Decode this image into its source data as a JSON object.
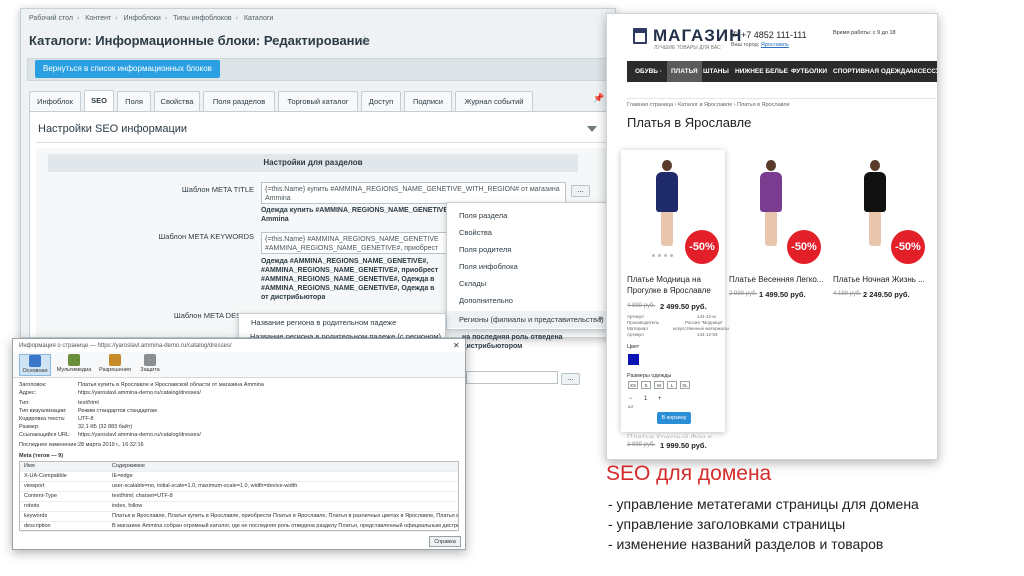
{
  "admin": {
    "breadcrumbs": [
      "Рабочий стол",
      "Контент",
      "Инфоблоки",
      "Типы инфоблоков",
      "Каталоги"
    ],
    "title": "Каталоги: Информационные блоки: Редактирование",
    "back_button": "Вернуться в список информационных блоков",
    "tabs": [
      "Инфоблок",
      "SEO",
      "Поля",
      "Свойства",
      "Поля разделов",
      "Торговый каталог",
      "Доступ",
      "Подписи",
      "Журнал событий"
    ],
    "active_tab": "SEO",
    "panel_title": "Настройки SEO информации",
    "section_title": "Настройки для разделов",
    "fields": {
      "meta_title_label": "Шаблон META TITLE",
      "meta_title_value": "{=this.Name} купить #AMMINA_REGIONS_NAME_GENETIVE_WITH_REGION# от магазина Ammina",
      "meta_title_preview_1": "Одежда купить #AMMINA_REGIONS_NAME_GENETIVE",
      "meta_title_preview_2": "Ammina",
      "meta_keywords_label": "Шаблон META KEYWORDS",
      "meta_keywords_value_1": "{=this.Name} #AMMINA_REGIONS_NAME_GENETIVE",
      "meta_keywords_value_2": "#AMMINA_REGIONS_NAME_GENETIVE#, приобрест",
      "meta_keywords_preview_1": "Одежда #AMMINA_REGIONS_NAME_GENETIVE#,",
      "meta_keywords_preview_2": "#AMMINA_REGIONS_NAME_GENETIVE#, приобрест",
      "meta_keywords_preview_3": "#AMMINA_REGIONS_NAME_GENETIVE#, Одежда в",
      "meta_keywords_preview_4": "#AMMINA_REGIONS_NAME_GENETIVE#, Одежда в",
      "meta_keywords_preview_5": "от дистрибьютора",
      "meta_description_label": "Шаблон META DESCRI",
      "desc_overflow_1": "на последняя роль отведена",
      "desc_overflow_2": "дистрибьютором",
      "dots": "..."
    },
    "popup_menu": [
      "Поля раздела",
      "Свойства",
      "Поля родителя",
      "Поля инфоблока",
      "Склады",
      "Дополнительно",
      "Регионы (филиалы и представительства)"
    ],
    "submenu_item": "Название региона в родительном падеже",
    "submenu_item_2": "Название региона в родительном падеже (с регионом)"
  },
  "page_info": {
    "title": "Информация о странице — https://yaroslavl.ammina-demo.ru/catalog/dresses/",
    "close": "✕",
    "toolbar": [
      "Основная",
      "Мультимедиа",
      "Разрешения",
      "Защита"
    ],
    "rows": [
      {
        "key": "Заголовок:",
        "value": "Платья купить в Ярославле и Ярославской области от магазина Ammina"
      },
      {
        "key": "Адрес:",
        "value": "https://yaroslavl.ammina-demo.ru/catalog/dresses/"
      },
      {
        "key": "Тип:",
        "value": "text/html"
      },
      {
        "key": "Тип визуализации:",
        "value": "Режим стандартов стандартам"
      },
      {
        "key": "Кодировка текста:",
        "value": "UTF-8"
      },
      {
        "key": "Размер:",
        "value": "32,1 КБ (32 883 байт)"
      },
      {
        "key": "Ссылающийся URL:",
        "value": "https://yaroslavl.ammina-demo.ru/catalog/dresses/"
      },
      {
        "key": "Последнее изменение:",
        "value": "28 марта 2019 г., 16:32:16"
      }
    ],
    "meta_heading": "Meta (тегов — 9)",
    "meta_columns": [
      "Имя",
      "Содержимое"
    ],
    "meta_rows": [
      {
        "name": "X-UA-Compatible",
        "content": "IE=edge"
      },
      {
        "name": "viewport",
        "content": "user-scalable=no, initial-scale=1.0, maximum-scale=1.0, width=device-width"
      },
      {
        "name": "Content-Type",
        "content": "text/html; charset=UTF-8"
      },
      {
        "name": "robots",
        "content": "index, follow"
      },
      {
        "name": "keywords",
        "content": "Платья в Ярославле, Платья купить в Ярославле, приобрести Платья в Ярославле, Платья в различных цветах в Ярославле, Платья в Ярославле от дистрибьютора"
      },
      {
        "name": "description",
        "content": "В магазине Ammina собран огромный каталог, где не последняя роль отведена разделу Платья, представленный официальным дистрибьютором в Ярославле и Яр"
      }
    ],
    "help_button": "Справка"
  },
  "shop": {
    "logo": "МАГАЗИН",
    "logo_sub": "ЛУЧШИЕ ТОВАРЫ ДЛЯ ВАС",
    "phone": "+7 4852 111-111",
    "city_label": "Ваш город:",
    "city": "Ярославль",
    "hours": "Время работы: с 9 до 18",
    "nav": [
      "ОБУВЬ ·",
      "ПЛАТЬЯ",
      "ШТАНЫ",
      "НИЖНЕЕ БЕЛЬЕ",
      "ФУТБОЛКИ",
      "СПОРТИВНАЯ ОДЕЖДА",
      "АКСЕССУ"
    ],
    "active_nav": "ПЛАТЬЯ",
    "breadcrumbs": "Главная страница  ›  Каталог в Ярославле  ›  Платья в Ярославле",
    "h1": "Платья в Ярославле",
    "products": [
      {
        "name_1": "Платье Модница на",
        "name_2": "Прогулке в Ярославле",
        "old": "4 899 руб.",
        "price": "2 499.50 руб.",
        "badge": "-50%",
        "color": "#1f2a6b"
      },
      {
        "name_1": "Платье Весенняя Легко...",
        "name_2": "",
        "old": "2 999 руб.",
        "price": "1 499.50 руб.",
        "badge": "-50%",
        "color": "#7a3c8e"
      },
      {
        "name_1": "Платье Ночная Жизнь ...",
        "name_2": "",
        "old": "4 199 руб.",
        "price": "2 249.50 руб.",
        "badge": "-50%",
        "color": "#111111"
      }
    ],
    "specs": [
      {
        "k": "Артикул",
        "v": "144-12-ю"
      },
      {
        "k": "Производитель",
        "v": "Россия \"Модница\""
      },
      {
        "k": "Материал",
        "v": "искусственные материалы"
      },
      {
        "k": "Артикул",
        "v": "144-12-03"
      }
    ],
    "color_label": "Цвет",
    "sizes_label": "Размеры одежды",
    "sizes": [
      "XS",
      "S",
      "M",
      "L",
      "XL"
    ],
    "qty_label": "шт",
    "qty": "1",
    "cart": "В корзину",
    "bottom_name": "Платье Красный Фон в",
    "bottom_old": "3 999 руб.",
    "bottom_price": "1 999.50 руб."
  },
  "caption": {
    "title": "SEO для домена",
    "items": [
      "- управление метатегами страницы для домена",
      "- управление заголовками страницы",
      "- изменение названий разделов и товаров"
    ]
  },
  "colors": {
    "accent_red": "#d62a2a",
    "admin_blue": "#2aa0e3",
    "badge_red": "#e3202a"
  }
}
